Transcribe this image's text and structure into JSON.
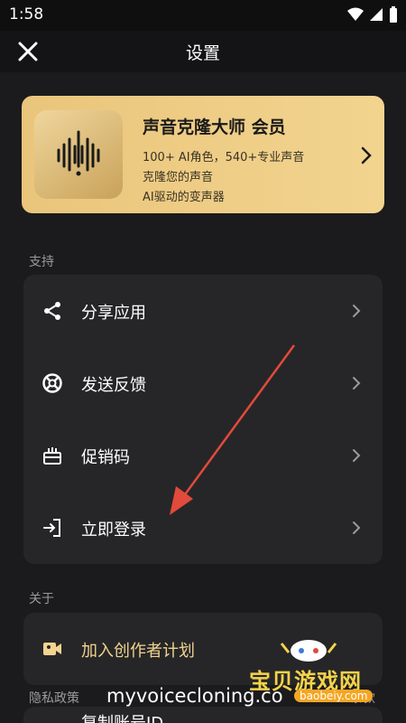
{
  "status_bar": {
    "time": "1:58"
  },
  "header": {
    "title": "设置"
  },
  "promo": {
    "title": "声音克隆大师 会员",
    "line1": "100+ AI角色，540+专业声音",
    "line2": "克隆您的声音",
    "line3": "AI驱动的变声器",
    "bg_color": "#eac57b"
  },
  "support": {
    "section_label": "支持",
    "items": [
      {
        "label": "分享应用",
        "icon": "share-icon"
      },
      {
        "label": "发送反馈",
        "icon": "lifebuoy-icon"
      },
      {
        "label": "促销码",
        "icon": "gift-box-icon"
      },
      {
        "label": "立即登录",
        "icon": "login-icon"
      }
    ]
  },
  "about": {
    "section_label": "关于",
    "items": [
      {
        "label": "加入创作者计划",
        "icon": "video-camera-icon"
      }
    ]
  },
  "footer": {
    "privacy_label": "隐私政策",
    "terms_label": "条款",
    "peek_label": "复制账号ID",
    "watermark_url": "myvoicecloning.co",
    "watermark_brand": "宝贝游戏网",
    "watermark_domain": "baobeiy.com"
  },
  "colors": {
    "accent_gold": "#f2d48f",
    "arrow_red": "#e24a3b",
    "card_bg": "#262628"
  }
}
